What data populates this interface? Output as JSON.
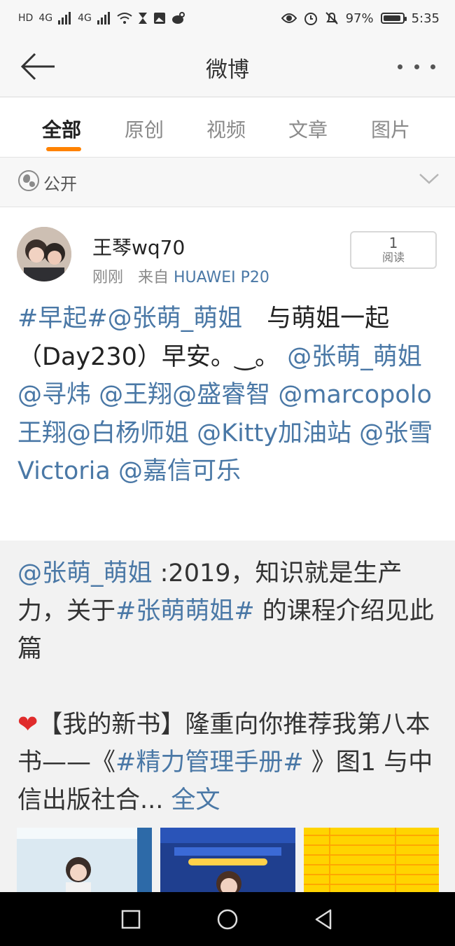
{
  "status_bar": {
    "left_labels": [
      "HD",
      "4G",
      "4G"
    ],
    "battery": "97%",
    "time": "5:35"
  },
  "topbar": {
    "title": "微博"
  },
  "tabs": [
    {
      "label": "全部",
      "active": true
    },
    {
      "label": "原创",
      "active": false
    },
    {
      "label": "视频",
      "active": false
    },
    {
      "label": "文章",
      "active": false
    },
    {
      "label": "图片",
      "active": false
    }
  ],
  "privacy": {
    "label": "公开"
  },
  "post": {
    "username": "王琴wq70",
    "time": "刚刚",
    "from_prefix": "来自",
    "source": "HUAWEI P20",
    "read_count": "1",
    "read_label": "阅读",
    "body": {
      "t1": "#早起#",
      "t2": "@张萌_萌姐",
      "t3": "　与萌姐一起（Day230）早安。‿。",
      "t4": "@张萌_萌姐",
      "t5": "@寻炜",
      "t6": "@王翔",
      "t7": "@盛睿智",
      "t8": "@marcopolo王翔",
      "t9": "@白杨师姐",
      "t10": "@Kitty加油站",
      "t11": "@张雪Victoria",
      "t12": "@嘉信可乐"
    }
  },
  "repost": {
    "mention": "@张萌_萌姐",
    "text1": " :2019，知识就是生产力，关于",
    "tag": "#张萌萌姐#",
    "text2": " 的课程介绍见此篇",
    "heart": "❤",
    "text3": "【我的新书】隆重向你推荐我第八本书——《",
    "book_tag": "#精力管理手册#",
    "text4": " 》图1 与中信出版社合...",
    "full_text": "全文",
    "images": [
      {
        "name": "image-1",
        "colors": [
          "#dbe9f2",
          "#2d6aa8"
        ]
      },
      {
        "name": "image-2",
        "colors": [
          "#1f3f8f",
          "#3b6ad6"
        ]
      },
      {
        "name": "image-3",
        "colors": [
          "#ffd400",
          "#ff9c00"
        ]
      }
    ]
  },
  "colors": {
    "accent": "#ff8200",
    "link": "#4a78a6"
  }
}
